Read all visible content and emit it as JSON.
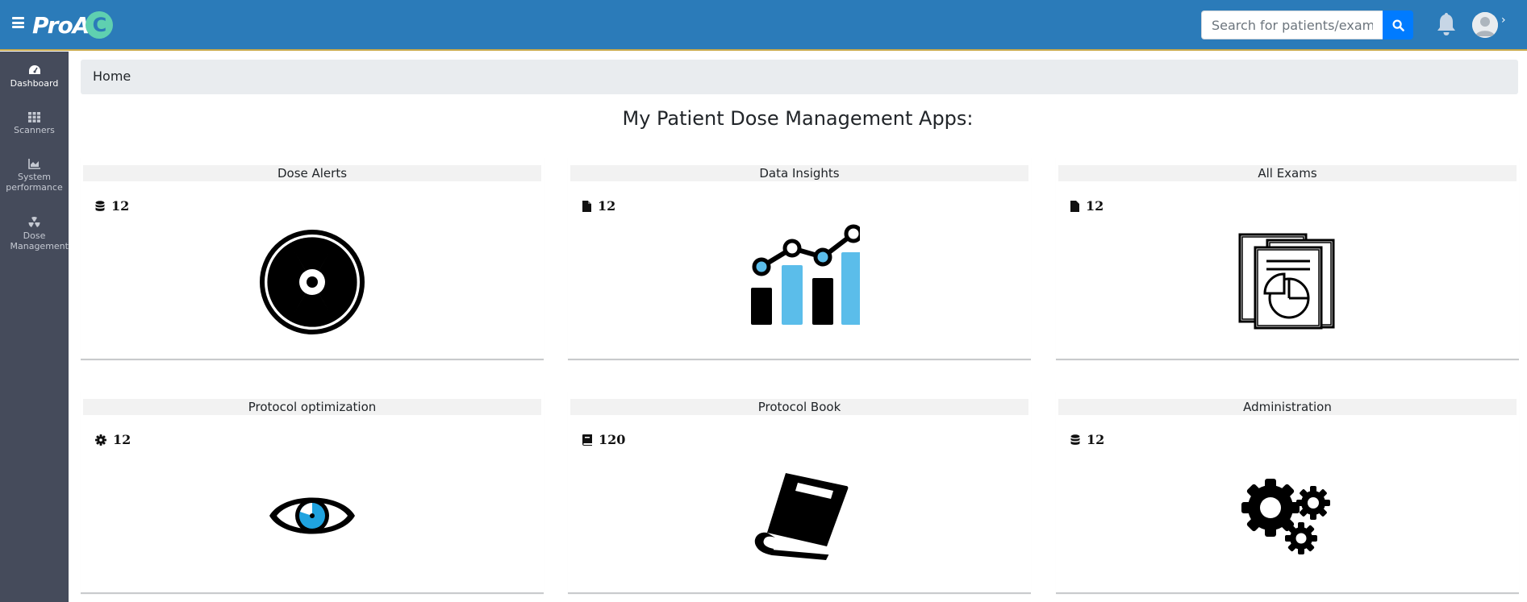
{
  "app": {
    "logo_text": "ProA",
    "logo_c": "C"
  },
  "search": {
    "placeholder": "Search for patients/exams"
  },
  "sidebar": {
    "items": [
      {
        "label": "Dashboard",
        "icon": "dashboard-icon"
      },
      {
        "label": "Scanners",
        "icon": "grid-icon"
      },
      {
        "label": "System performance",
        "icon": "chart-icon"
      },
      {
        "label": "Dose Management",
        "icon": "radiation-icon"
      }
    ]
  },
  "breadcrumb": "Home",
  "page_title": "My Patient Dose Management Apps:",
  "cards": [
    {
      "title": "Dose Alerts",
      "count": "12",
      "count_icon": "database-icon",
      "image": "radiation-symbol"
    },
    {
      "title": "Data Insights",
      "count": "12",
      "count_icon": "file-icon",
      "image": "bar-line-chart"
    },
    {
      "title": "All Exams",
      "count": "12",
      "count_icon": "file-icon",
      "image": "documents-report"
    },
    {
      "title": "Protocol optimization",
      "count": "12",
      "count_icon": "gear-icon",
      "image": "eye"
    },
    {
      "title": "Protocol Book",
      "count": "120",
      "count_icon": "book-icon",
      "image": "book"
    },
    {
      "title": "Administration",
      "count": "12",
      "count_icon": "database-icon",
      "image": "gears"
    }
  ],
  "colors": {
    "topbar": "#2b7bb9",
    "sidebar": "#454b5b",
    "accent_blue": "#5bbdea",
    "search_button": "#007bff"
  }
}
